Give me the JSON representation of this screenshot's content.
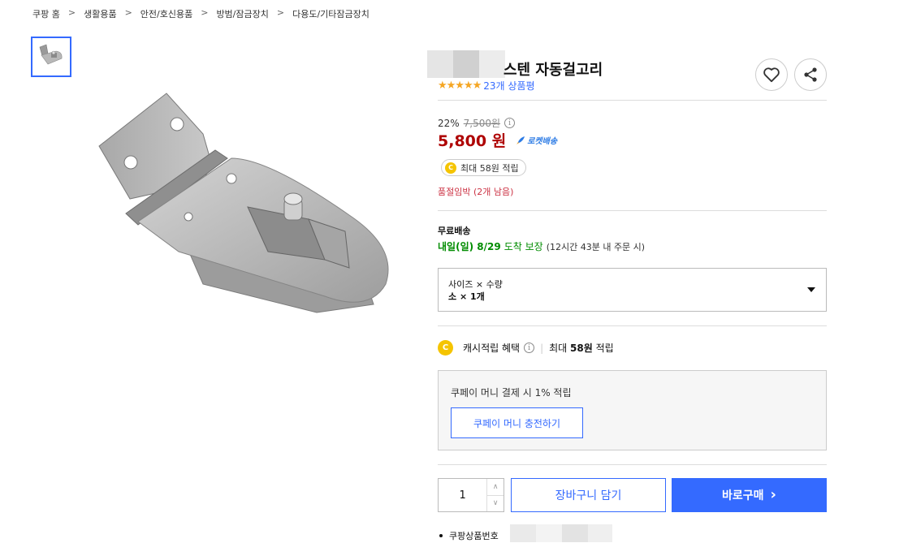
{
  "breadcrumb": [
    "쿠팡 홈",
    "생활용품",
    "안전/호신용품",
    "방범/잠금장치",
    "다용도/기타잠금장치"
  ],
  "breadcrumb_sep": ">",
  "product": {
    "title": "스텐 자동걸고리",
    "rating_stars": 4.5,
    "stars_text": "★★★★★",
    "review_count": "23개 상품평"
  },
  "price": {
    "discount_rate": "22%",
    "original": "7,500원",
    "sale_value": "5,800",
    "sale_unit": "원",
    "rocket_label": "로켓배송"
  },
  "cash_badge": "최대 58원 적립",
  "stock_notice": "품절임박 (2개 남음)",
  "shipping": {
    "label": "무료배송",
    "date": "내일(일) 8/29",
    "arrival": "도착 보장",
    "note": "(12시간 43분 내 주문 시)"
  },
  "option": {
    "label": "사이즈 × 수량",
    "value": "소 × 1개"
  },
  "cash_benefit": {
    "label": "캐시적립 혜택",
    "value_prefix": "최대",
    "value": "58원",
    "value_suffix": "적립"
  },
  "coupay": {
    "text": "쿠페이 머니 결제 시 1% 적립",
    "button": "쿠페이 머니 충전하기"
  },
  "purchase": {
    "quantity": "1",
    "cart_button": "장바구니 담기",
    "buy_button": "바로구매",
    "buy_arrow": "›"
  },
  "product_number_label": "쿠팡상품번호",
  "icons": {
    "heart": "heart-icon",
    "share": "share-icon",
    "info": "info-icon",
    "coin": "coin-icon",
    "rocket": "rocket-icon",
    "caret": "caret-down-icon"
  },
  "colors": {
    "accent": "#346aff",
    "sale_price": "#ae0000",
    "stock": "#cc3344",
    "delivery": "#008c00",
    "coin": "#f5c400",
    "star": "#f5a623"
  }
}
